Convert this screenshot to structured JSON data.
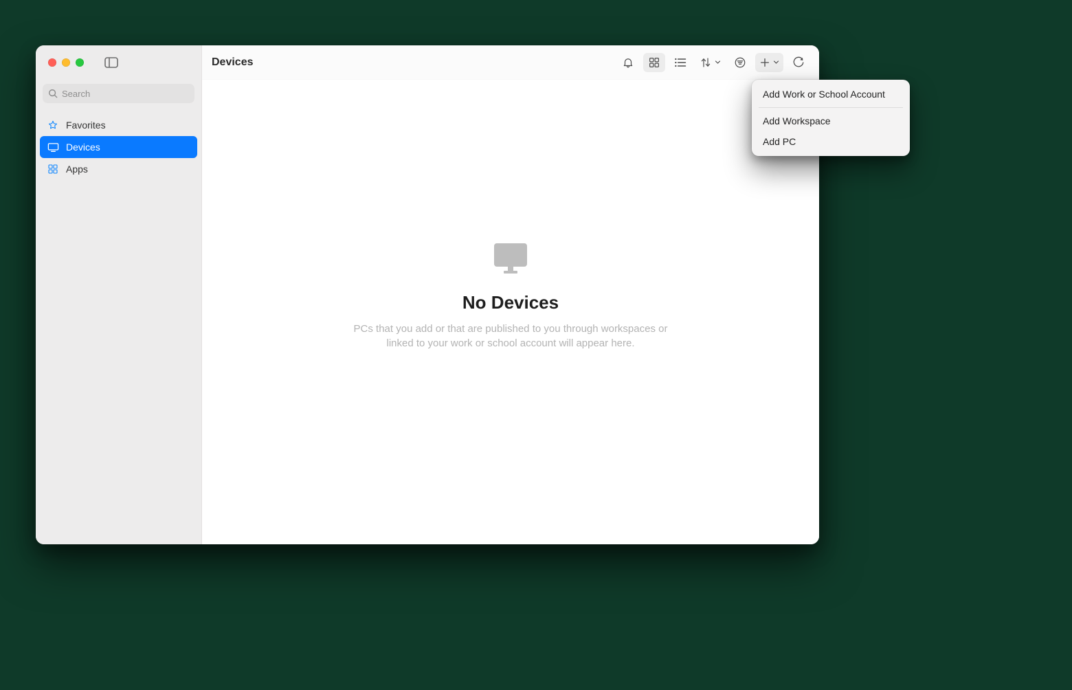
{
  "header": {
    "title": "Devices"
  },
  "search": {
    "placeholder": "Search",
    "value": ""
  },
  "sidebar": {
    "items": [
      {
        "id": "favorites",
        "label": "Favorites",
        "icon": "star-icon",
        "selected": false
      },
      {
        "id": "devices",
        "label": "Devices",
        "icon": "display-icon",
        "selected": true
      },
      {
        "id": "apps",
        "label": "Apps",
        "icon": "apps-grid-icon",
        "selected": false
      }
    ]
  },
  "toolbar": {
    "icons": {
      "notifications": "bell-icon",
      "view_grid": "grid-view-icon",
      "view_list": "list-view-icon",
      "sort": "sort-arrows-icon",
      "filter": "filter-icon",
      "add": "plus-icon",
      "refresh": "refresh-icon"
    },
    "active_view": "grid"
  },
  "empty_state": {
    "title": "No Devices",
    "description": "PCs that you add or that are published to you through workspaces or linked to your work or school account will appear here."
  },
  "add_menu": {
    "group1": [
      {
        "id": "add-account",
        "label": "Add Work or School Account"
      }
    ],
    "group2": [
      {
        "id": "add-workspace",
        "label": "Add Workspace"
      },
      {
        "id": "add-pc",
        "label": "Add PC"
      }
    ]
  },
  "colors": {
    "accent": "#0a7aff",
    "icon_blue": "#0a84ff"
  }
}
